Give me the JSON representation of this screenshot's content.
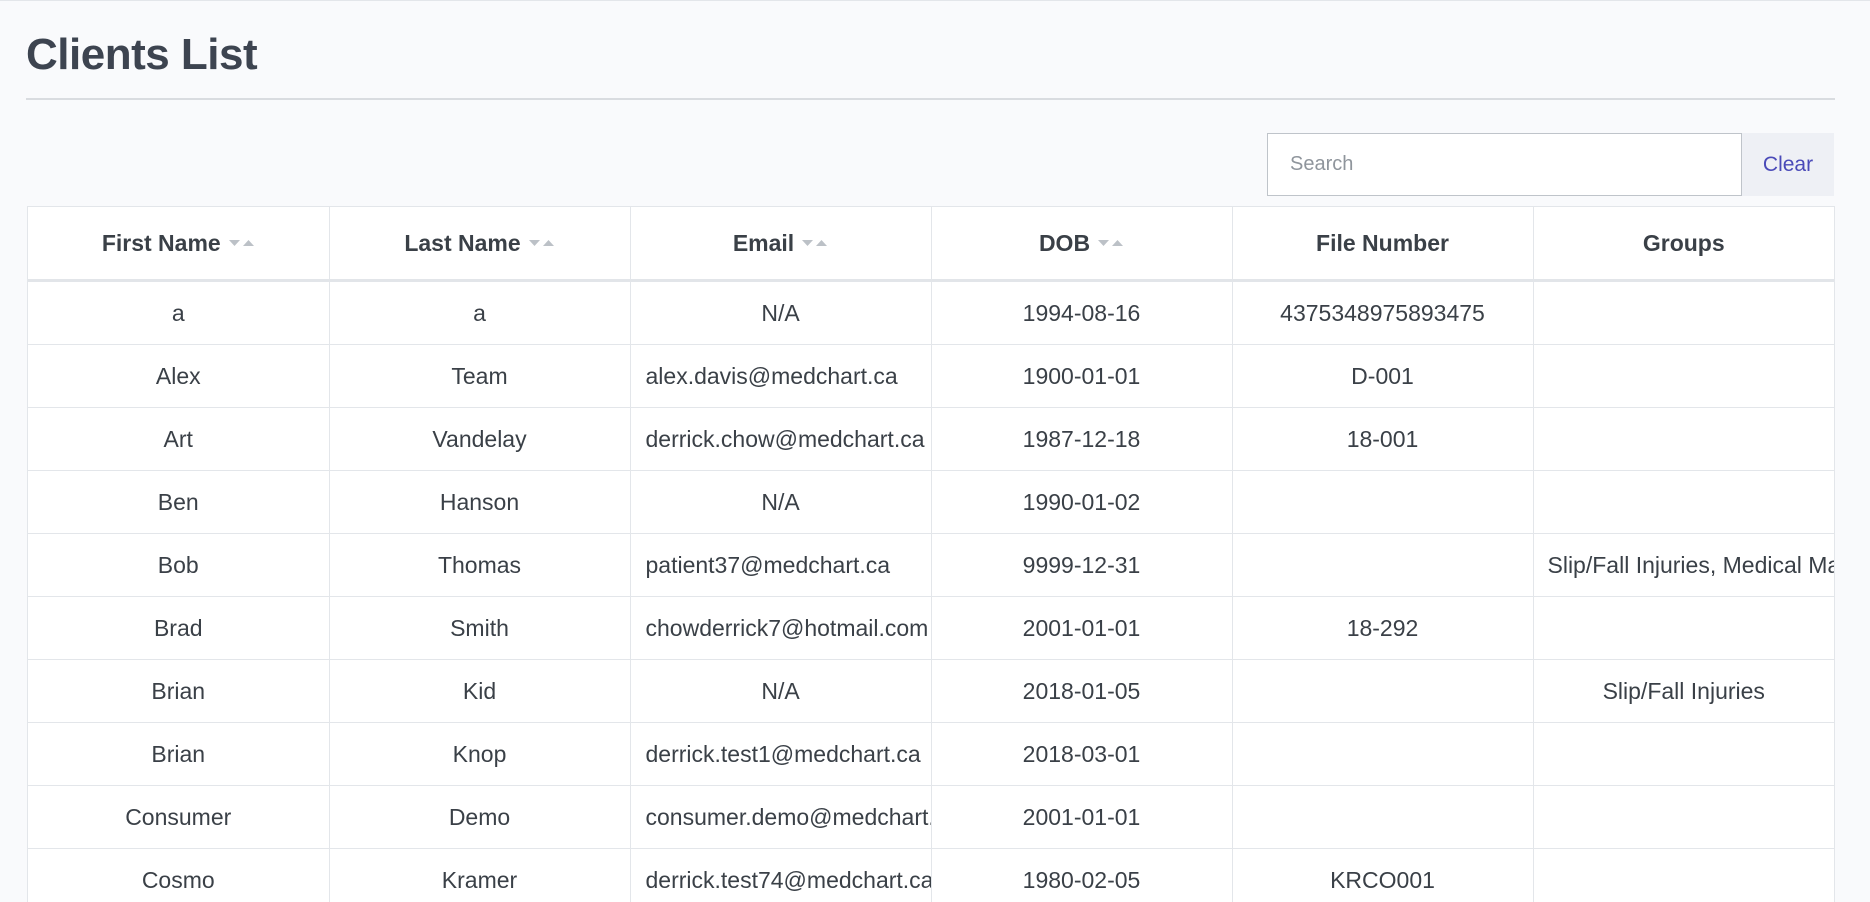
{
  "page": {
    "title": "Clients List"
  },
  "search": {
    "placeholder": "Search",
    "value": "",
    "clear_label": "Clear"
  },
  "table": {
    "columns": [
      {
        "label": "First Name",
        "sortable": true,
        "icon": "sort-icon"
      },
      {
        "label": "Last Name",
        "sortable": true,
        "icon": "sort-icon"
      },
      {
        "label": "Email",
        "sortable": true,
        "icon": "sort-icon"
      },
      {
        "label": "DOB",
        "sortable": true,
        "icon": "sort-icon"
      },
      {
        "label": "File Number",
        "sortable": false
      },
      {
        "label": "Groups",
        "sortable": false
      }
    ],
    "rows": [
      {
        "first": "a",
        "last": "a",
        "email": "N/A",
        "dob": "1994-08-16",
        "file": "4375348975893475",
        "groups": ""
      },
      {
        "first": "Alex",
        "last": "Team",
        "email": "alex.davis@medchart.ca",
        "dob": "1900-01-01",
        "file": "D-001",
        "groups": ""
      },
      {
        "first": "Art",
        "last": "Vandelay",
        "email": "derrick.chow@medchart.ca",
        "dob": "1987-12-18",
        "file": "18-001",
        "groups": ""
      },
      {
        "first": "Ben",
        "last": "Hanson",
        "email": "N/A",
        "dob": "1990-01-02",
        "file": "",
        "groups": ""
      },
      {
        "first": "Bob",
        "last": "Thomas",
        "email": "patient37@medchart.ca",
        "dob": "9999-12-31",
        "file": "",
        "groups": "Slip/Fall Injuries, Medical Malpractice"
      },
      {
        "first": "Brad",
        "last": "Smith",
        "email": "chowderrick7@hotmail.com",
        "dob": "2001-01-01",
        "file": "18-292",
        "groups": ""
      },
      {
        "first": "Brian",
        "last": "Kid",
        "email": "N/A",
        "dob": "2018-01-05",
        "file": "",
        "groups": "Slip/Fall Injuries"
      },
      {
        "first": "Brian",
        "last": "Knop",
        "email": "derrick.test1@medchart.ca",
        "dob": "2018-03-01",
        "file": "",
        "groups": ""
      },
      {
        "first": "Consumer",
        "last": "Demo",
        "email": "consumer.demo@medchart.ca",
        "dob": "2001-01-01",
        "file": "",
        "groups": ""
      },
      {
        "first": "Cosmo",
        "last": "Kramer",
        "email": "derrick.test74@medchart.ca",
        "dob": "1980-02-05",
        "file": "KRCO001",
        "groups": ""
      }
    ]
  }
}
